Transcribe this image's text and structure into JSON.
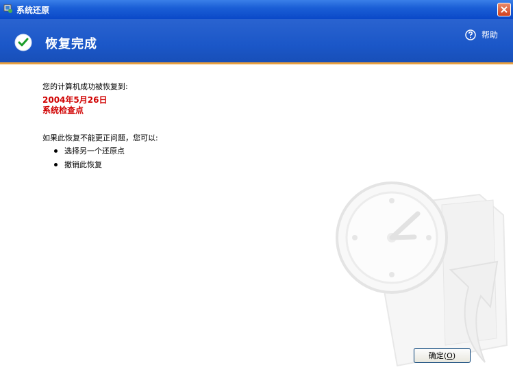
{
  "window": {
    "title": "系统还原"
  },
  "header": {
    "title": "恢复完成",
    "help_label": "帮助"
  },
  "content": {
    "success_message": "您的计算机成功被恢复到:",
    "restore_date": "2004年5月26日",
    "restore_point": "系统检查点",
    "problem_message": "如果此恢复不能更正问题，您可以:",
    "options": [
      "选择另一个还原点",
      "撤销此恢复"
    ]
  },
  "buttons": {
    "ok_label": "确定(",
    "ok_accel": "O",
    "ok_suffix": ")"
  },
  "colors": {
    "header_bg": "#1b57c8",
    "accent_line": "#e8a040",
    "highlight_text": "#d00000"
  }
}
